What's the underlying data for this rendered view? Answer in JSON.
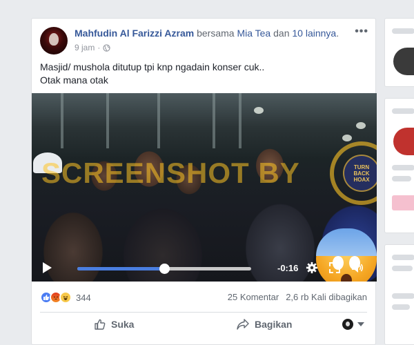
{
  "post": {
    "author": "Mahfudin Al Farizzi Azram",
    "with_text": " bersama ",
    "tagged": "Mia Tea",
    "and_text": " dan ",
    "others": "10 lainnya",
    "period": ".",
    "time": "9 jam",
    "separator": "·",
    "text_line1": "Masjid/ mushola ditutup tpi knp ngadain konser cuk..",
    "text_line2": "Otak mana otak"
  },
  "video": {
    "watermark": "SCREENSHOT BY",
    "seal_line1": "TURN",
    "seal_line2": "BACK",
    "seal_line3": "HOAX",
    "time_remaining": "-0:16",
    "progress": 0.5
  },
  "reactions": {
    "count": "344",
    "icons": [
      "like-icon",
      "angry-icon",
      "haha-icon"
    ]
  },
  "stats": {
    "comments": "25 Komentar",
    "shares": "2,6 rb Kali dibagikan"
  },
  "actions": {
    "like": "Suka",
    "share": "Bagikan"
  },
  "colors": {
    "link": "#365899",
    "progress": "#4a7ee0",
    "background": "#e9ebee"
  }
}
